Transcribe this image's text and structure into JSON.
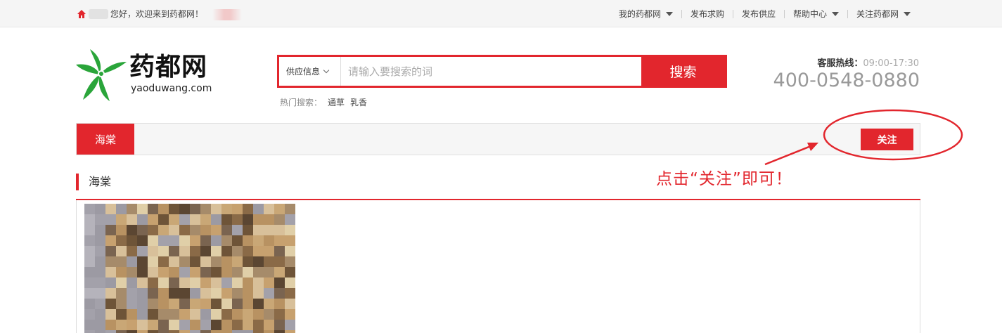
{
  "topbar": {
    "greeting": "您好，欢迎来到药都网！",
    "nav": [
      {
        "label": "我的药都网",
        "dropdown": true
      },
      {
        "label": "发布求购",
        "dropdown": false
      },
      {
        "label": "发布供应",
        "dropdown": false
      },
      {
        "label": "帮助中心",
        "dropdown": true
      },
      {
        "label": "关注药都网",
        "dropdown": true
      }
    ]
  },
  "logo": {
    "cn": "药都网",
    "en": "yaoduwang.com"
  },
  "search": {
    "type_label": "供应信息",
    "placeholder": "请输入要搜索的词",
    "button_label": "搜索"
  },
  "hot_search": {
    "label": "热门搜索：",
    "keywords": [
      "通草",
      "乳香"
    ]
  },
  "hotline": {
    "label": "客服热线：",
    "hours": "09:00-17:30",
    "number": "400-0548-0880"
  },
  "shop": {
    "tab_label": "海棠",
    "follow_label": "关注"
  },
  "annotation": {
    "text": "点击“关注”即可！"
  },
  "section": {
    "title": "海棠"
  },
  "colors": {
    "accent": "#e2262d",
    "logo_green": "#2aa53a"
  }
}
